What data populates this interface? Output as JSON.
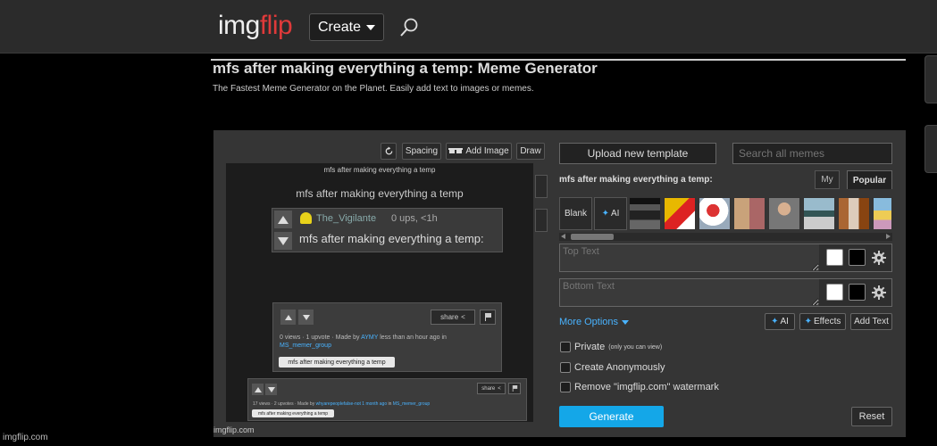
{
  "header": {
    "logo_img": "img",
    "logo_flip": "flip",
    "create_label": "Create",
    "search_icon": "search-icon"
  },
  "page": {
    "title": "mfs after making everything a temp: Meme Generator",
    "subtitle": "The Fastest Meme Generator on the Planet. Easily add text to images or memes."
  },
  "toolbar": {
    "spacing_label": "Spacing",
    "add_image_label": "Add Image",
    "draw_label": "Draw"
  },
  "canvas": {
    "small_title": "mfs after making everything a temp",
    "title": "mfs after making everything a temp",
    "post1": {
      "username": "The_Vigilante",
      "meta": "0 ups, <1h",
      "caption": "mfs after making everything a temp:"
    },
    "post2": {
      "share_label": "share",
      "stats_prefix": "0 views · 1 upvote · Made by",
      "author": "AYMY",
      "stats_suffix": "less than an hour ago in",
      "group": "MS_memer_group",
      "tag": "mfs after making everything a temp"
    },
    "post3": {
      "share_label": "share",
      "stats_prefix": "17 views · 2 upvotes · Made by",
      "author": "whyarepeoplefalse-not",
      "age": "1 month ago",
      "stats_mid": "in",
      "group": "MS_memer_group",
      "tag": "mfs after making everything a temp"
    },
    "watermark": "imgflip.com"
  },
  "editor": {
    "upload_label": "Upload new template",
    "search_placeholder": "Search all memes",
    "template_name": "mfs after making everything a temp:",
    "tab_my": "My",
    "tab_popular": "Popular",
    "blank_label": "Blank",
    "ai_tile_label": "AI",
    "top_text_placeholder": "Top Text",
    "bottom_text_placeholder": "Bottom Text",
    "more_options_label": "More Options",
    "ai_btn_label": "AI",
    "effects_label": "Effects",
    "add_text_label": "Add Text",
    "private_label": "Private",
    "private_note": "(only you can view)",
    "anon_label": "Create Anonymously",
    "watermark_label": "Remove \"imgflip.com\" watermark",
    "generate_label": "Generate",
    "reset_label": "Reset"
  },
  "footer": {
    "watermark": "imgflip.com"
  },
  "colors": {
    "accent": "#14a7e8",
    "logo_red": "#e03a3a",
    "link": "#49b3ff"
  }
}
